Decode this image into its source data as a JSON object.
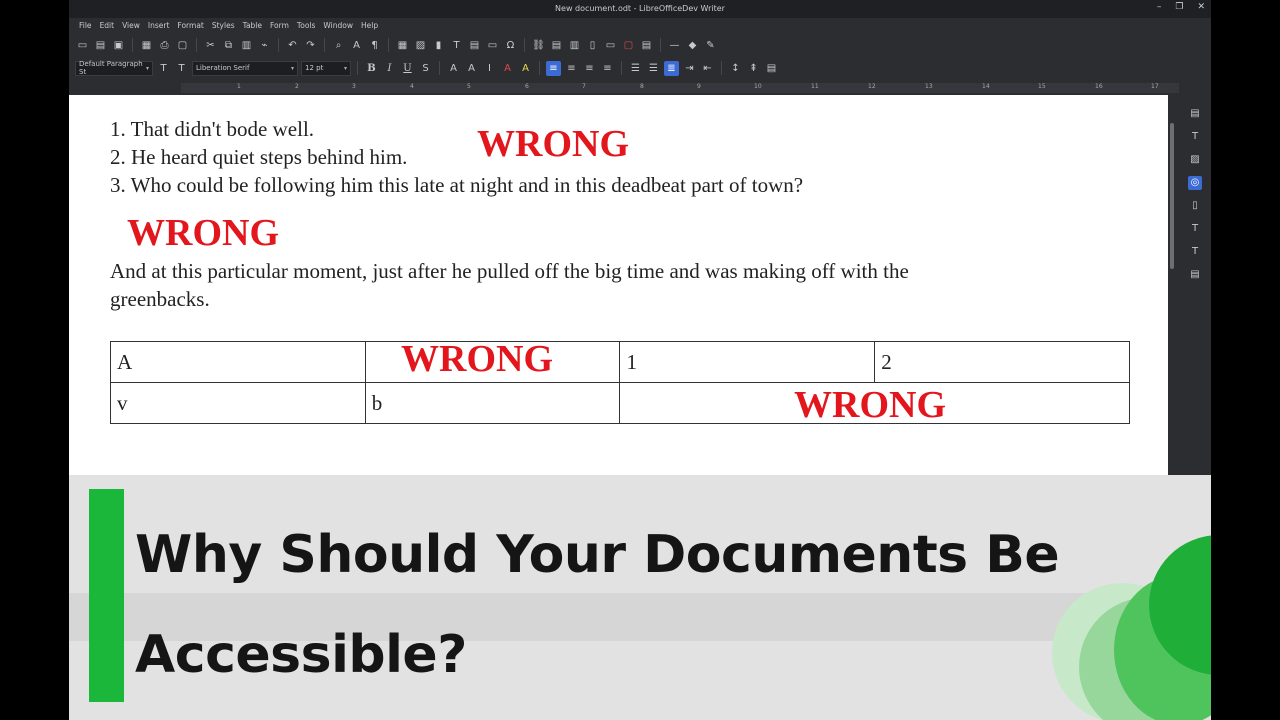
{
  "window": {
    "title": "New document.odt - LibreOfficeDev Writer"
  },
  "menu": [
    "File",
    "Edit",
    "View",
    "Insert",
    "Format",
    "Styles",
    "Table",
    "Form",
    "Tools",
    "Window",
    "Help"
  ],
  "formatting": {
    "paragraph_style": "Default Paragraph St",
    "font_name": "Liberation Serif",
    "font_size": "12 pt"
  },
  "ruler": {
    "numbers": [
      "1",
      "2",
      "3",
      "4",
      "5",
      "6",
      "7",
      "8",
      "9",
      "10",
      "11",
      "12",
      "13",
      "14",
      "15",
      "16",
      "17",
      "18"
    ]
  },
  "document": {
    "list": [
      "1. That didn't bode well.",
      "2. He heard quiet steps behind him.",
      "3. Who could be following him this late at night and in this deadbeat part of town?"
    ],
    "paragraph_line1": "And at this particular moment, just after he pulled off the big time and was making off with the",
    "paragraph_line2": "greenbacks.",
    "table": [
      [
        "A",
        "",
        "1",
        "2"
      ],
      [
        "v",
        "b",
        "",
        ""
      ]
    ],
    "wrong_label": "WRONG"
  },
  "caption": {
    "line1": "Why Should Your Documents Be",
    "line2": "Accessible?"
  },
  "colors": {
    "wrong": "#e2161c",
    "accent_green": "#1bb73b",
    "selection_blue": "#3d6bd6"
  }
}
